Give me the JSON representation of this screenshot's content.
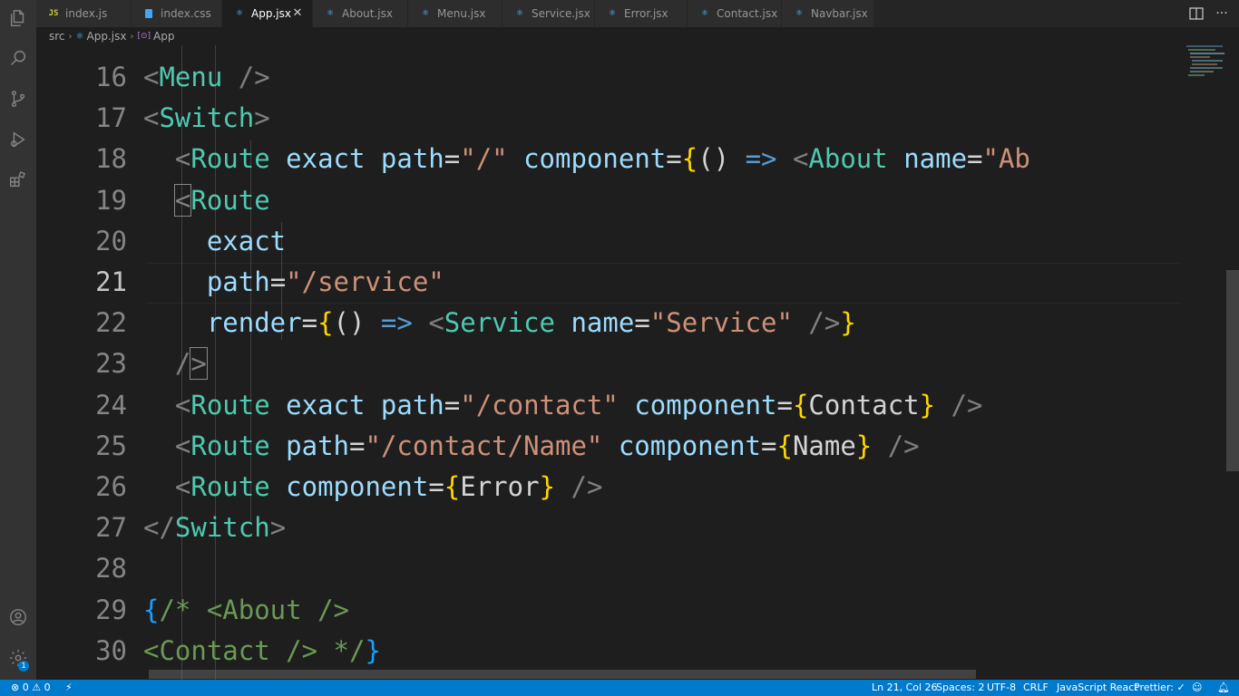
{
  "tabs": [
    {
      "label": "index.js",
      "icon": "js-icon"
    },
    {
      "label": "index.css",
      "icon": "css-icon"
    },
    {
      "label": "App.jsx",
      "icon": "react-icon",
      "active": true
    },
    {
      "label": "About.jsx",
      "icon": "react-icon"
    },
    {
      "label": "Menu.jsx",
      "icon": "react-icon"
    },
    {
      "label": "Service.jsx",
      "icon": "react-icon"
    },
    {
      "label": "Error.jsx",
      "icon": "react-icon"
    },
    {
      "label": "Contact.jsx",
      "icon": "react-icon"
    },
    {
      "label": "Navbar.jsx",
      "icon": "react-icon"
    }
  ],
  "breadcrumb": [
    "src",
    "App.jsx",
    "App"
  ],
  "editor": {
    "active_line": 21,
    "lines": [
      {
        "n": "16",
        "tokens": [
          [
            "<",
            "t-punc"
          ],
          [
            "Menu",
            "t-tag"
          ],
          [
            " />",
            "t-punc"
          ]
        ]
      },
      {
        "n": "17",
        "tokens": [
          [
            "<",
            "t-punc"
          ],
          [
            "Switch",
            "t-tag"
          ],
          [
            ">",
            "t-punc"
          ]
        ]
      },
      {
        "n": "18",
        "tokens": [
          [
            "  <",
            "t-punc"
          ],
          [
            "Route",
            "t-tag"
          ],
          [
            " exact",
            "t-attr"
          ],
          [
            " path",
            "t-attr"
          ],
          [
            "=",
            "t-plain"
          ],
          [
            "\"/\"",
            "t-str"
          ],
          [
            " component",
            "t-attr"
          ],
          [
            "=",
            "t-plain"
          ],
          [
            "{",
            "t-brace"
          ],
          [
            "()",
            "t-plain"
          ],
          [
            " =>",
            "t-arrow"
          ],
          [
            " <",
            "t-punc"
          ],
          [
            "About",
            "t-tag"
          ],
          [
            " name",
            "t-attr"
          ],
          [
            "=",
            "t-plain"
          ],
          [
            "\"Ab",
            "t-str"
          ]
        ]
      },
      {
        "n": "19",
        "tokens": [
          [
            "  ",
            "t-plain"
          ],
          [
            "<",
            "t-punc bm"
          ],
          [
            "Route",
            "t-tag"
          ]
        ]
      },
      {
        "n": "20",
        "tokens": [
          [
            "    exact",
            "t-attr"
          ]
        ]
      },
      {
        "n": "21",
        "tokens": [
          [
            "    path",
            "t-attr"
          ],
          [
            "=",
            "t-plain"
          ],
          [
            "\"/service\"",
            "t-str"
          ]
        ]
      },
      {
        "n": "22",
        "tokens": [
          [
            "    render",
            "t-attr"
          ],
          [
            "=",
            "t-plain"
          ],
          [
            "{",
            "t-brace"
          ],
          [
            "()",
            "t-plain"
          ],
          [
            " =>",
            "t-arrow"
          ],
          [
            " <",
            "t-punc"
          ],
          [
            "Service",
            "t-tag"
          ],
          [
            " name",
            "t-attr"
          ],
          [
            "=",
            "t-plain"
          ],
          [
            "\"Service\"",
            "t-str"
          ],
          [
            " />",
            "t-punc"
          ],
          [
            "}",
            "t-brace"
          ]
        ]
      },
      {
        "n": "23",
        "tokens": [
          [
            "  /",
            "t-punc"
          ],
          [
            ">",
            "t-punc bm"
          ]
        ]
      },
      {
        "n": "24",
        "tokens": [
          [
            "  <",
            "t-punc"
          ],
          [
            "Route",
            "t-tag"
          ],
          [
            " exact",
            "t-attr"
          ],
          [
            " path",
            "t-attr"
          ],
          [
            "=",
            "t-plain"
          ],
          [
            "\"/contact\"",
            "t-str"
          ],
          [
            " component",
            "t-attr"
          ],
          [
            "=",
            "t-plain"
          ],
          [
            "{",
            "t-brace"
          ],
          [
            "Contact",
            "t-plain"
          ],
          [
            "}",
            "t-brace"
          ],
          [
            " />",
            "t-punc"
          ]
        ]
      },
      {
        "n": "25",
        "tokens": [
          [
            "  <",
            "t-punc"
          ],
          [
            "Route",
            "t-tag"
          ],
          [
            " path",
            "t-attr"
          ],
          [
            "=",
            "t-plain"
          ],
          [
            "\"/contact/Name\"",
            "t-str"
          ],
          [
            " component",
            "t-attr"
          ],
          [
            "=",
            "t-plain"
          ],
          [
            "{",
            "t-brace"
          ],
          [
            "Name",
            "t-plain"
          ],
          [
            "}",
            "t-brace"
          ],
          [
            " />",
            "t-punc"
          ]
        ]
      },
      {
        "n": "26",
        "tokens": [
          [
            "  <",
            "t-punc"
          ],
          [
            "Route",
            "t-tag"
          ],
          [
            " component",
            "t-attr"
          ],
          [
            "=",
            "t-plain"
          ],
          [
            "{",
            "t-brace"
          ],
          [
            "Error",
            "t-plain"
          ],
          [
            "}",
            "t-brace"
          ],
          [
            " />",
            "t-punc"
          ]
        ]
      },
      {
        "n": "27",
        "tokens": [
          [
            "</",
            "t-punc"
          ],
          [
            "Switch",
            "t-tag"
          ],
          [
            ">",
            "t-punc"
          ]
        ]
      },
      {
        "n": "28",
        "tokens": []
      },
      {
        "n": "29",
        "tokens": [
          [
            "{",
            "t-brace2"
          ],
          [
            "/* <About />",
            "t-comment"
          ]
        ]
      },
      {
        "n": "30",
        "tokens": [
          [
            "<Contact /> */",
            "t-comment"
          ],
          [
            "}",
            "t-brace2"
          ]
        ]
      }
    ]
  },
  "status": {
    "errors": "0",
    "warnings": "0",
    "position": "Ln 21, Col 26",
    "spaces": "Spaces: 2",
    "encoding": "UTF-8",
    "eol": "CRLF",
    "language": "JavaScript React",
    "formatter": "Prettier: ✓"
  },
  "settings_badge": "1",
  "colors": {
    "accent": "#007acc",
    "tag": "#4ec9b0",
    "attr": "#9cdcfe",
    "string": "#ce9178",
    "brace": "#ffd700"
  }
}
